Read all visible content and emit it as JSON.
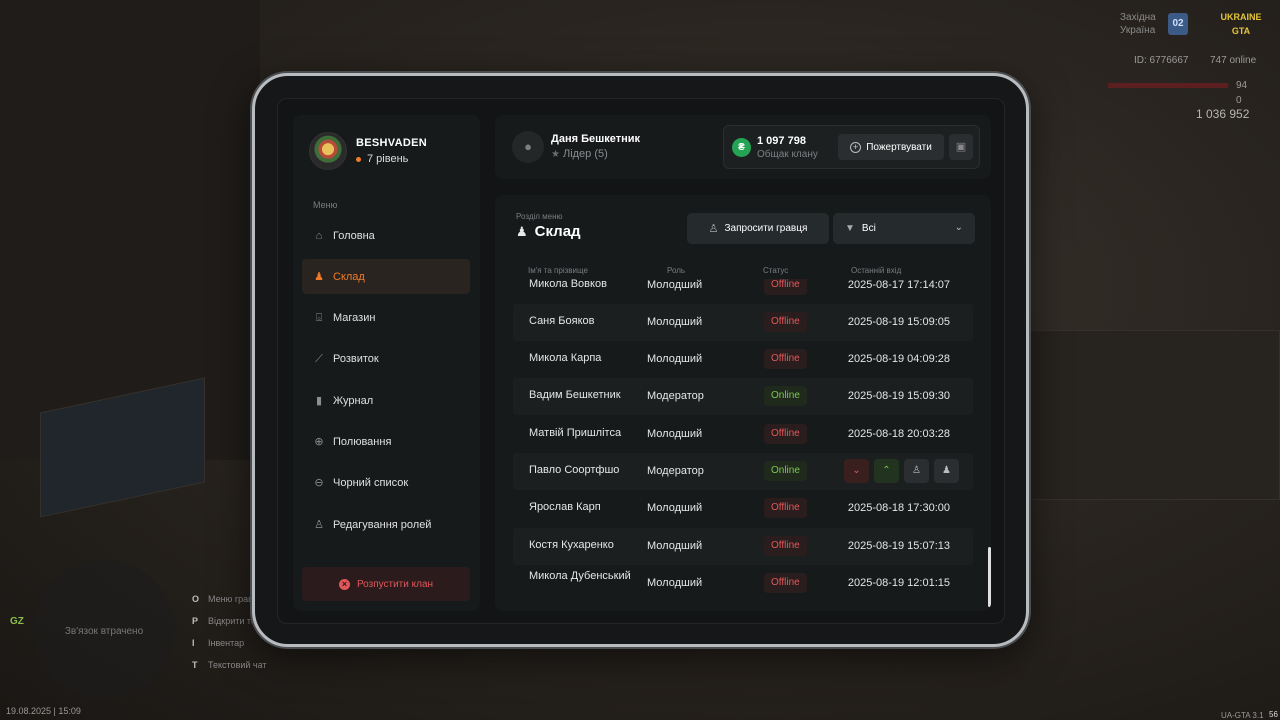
{
  "hud": {
    "region_line1": "Західна",
    "region_line2": "Україна",
    "region_badge": "02",
    "server_logo": "UKRAINE GTA",
    "player_id": "ID: 6776667",
    "online": "747 online",
    "health": "94",
    "armor": "0",
    "money": "1 036 952",
    "datetime": "19.08.2025 | 15:09",
    "version": "UA-GTA 3.1",
    "fps": "56",
    "minimap_text": "Зв'язок втрачено",
    "zone_label": "GZ",
    "keys": [
      {
        "key": "O",
        "label": "Меню гравця"
      },
      {
        "key": "P",
        "label": "Відкрити телефон"
      },
      {
        "key": "I",
        "label": "Інвентар"
      },
      {
        "key": "T",
        "label": "Текстовий чат"
      }
    ]
  },
  "profile": {
    "name": "BESHVADEN",
    "level": "7 рівень"
  },
  "menu_label": "Меню",
  "menu": [
    {
      "label": "Головна",
      "icon": "home-icon",
      "glyph": "⌂",
      "active": false
    },
    {
      "label": "Склад",
      "icon": "group-icon",
      "glyph": "♟",
      "active": true
    },
    {
      "label": "Магазин",
      "icon": "basket-icon",
      "glyph": "⌺",
      "active": false
    },
    {
      "label": "Розвиток",
      "icon": "chart-icon",
      "glyph": "⟋",
      "active": false
    },
    {
      "label": "Журнал",
      "icon": "book-icon",
      "glyph": "▮",
      "active": false
    },
    {
      "label": "Полювання",
      "icon": "crosshair-icon",
      "glyph": "⊕",
      "active": false
    },
    {
      "label": "Чорний список",
      "icon": "block-icon",
      "glyph": "⊖",
      "active": false
    },
    {
      "label": "Редагування ролей",
      "icon": "user-edit-icon",
      "glyph": "♙",
      "active": false
    }
  ],
  "disband_label": "Розпустити клан",
  "user": {
    "name": "Даня Бешкетник",
    "role": "Лідер (5)"
  },
  "clan_money": {
    "value": "1 097 798",
    "label": "Общак клану",
    "currency_symbol": "₴"
  },
  "donate_label": "Пожертвувати",
  "section": {
    "label": "Розділ меню",
    "title": "Склад"
  },
  "invite_label": "Запросити гравця",
  "filter_value": "Всі",
  "columns": {
    "name": "Ім'я та прізвище",
    "role": "Роль",
    "status": "Статус",
    "last": "Останній вхід"
  },
  "members": [
    {
      "name": "Микола Вовков",
      "role": "Молодший",
      "status": "Offline",
      "last": "2025-08-17 17:14:07"
    },
    {
      "name": "Саня Бояков",
      "role": "Молодший",
      "status": "Offline",
      "last": "2025-08-19 15:09:05"
    },
    {
      "name": "Микола Карпа",
      "role": "Молодший",
      "status": "Offline",
      "last": "2025-08-19 04:09:28"
    },
    {
      "name": "Вадим Бешкетник",
      "role": "Модератор",
      "status": "Online",
      "last": "2025-08-19 15:09:30"
    },
    {
      "name": "Матвій Пришлітса",
      "role": "Молодший",
      "status": "Offline",
      "last": "2025-08-18 20:03:28"
    },
    {
      "name": "Павло Соортфшо",
      "role": "Модератор",
      "status": "Online",
      "last": ""
    },
    {
      "name": "Ярослав Карп",
      "role": "Молодший",
      "status": "Offline",
      "last": "2025-08-18 17:30:00"
    },
    {
      "name": "Костя Кухаренко",
      "role": "Молодший",
      "status": "Offline",
      "last": "2025-08-19 15:07:13"
    },
    {
      "name": "Микола Дубенський",
      "role": "Молодший",
      "status": "Offline",
      "last": "2025-08-19 12:01:15"
    }
  ]
}
